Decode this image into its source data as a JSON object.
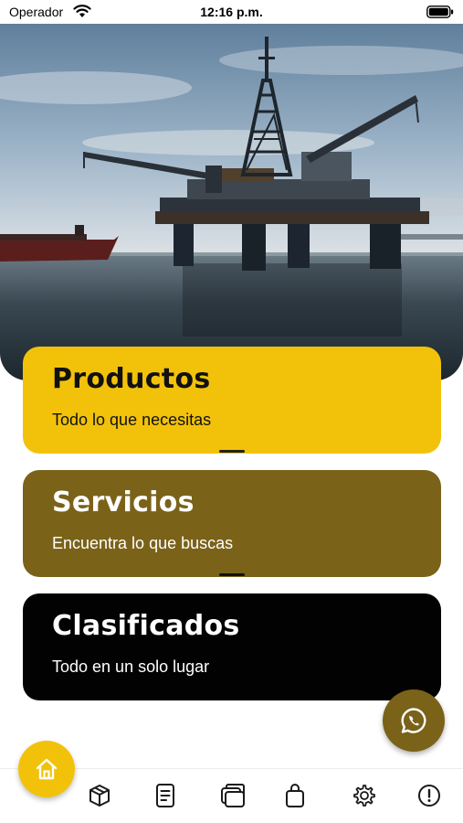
{
  "status_bar": {
    "carrier": "Operador",
    "time": "12:16 p.m."
  },
  "hero": {
    "image": "offshore-oil-platform-image"
  },
  "cards": [
    {
      "title": "Productos",
      "subtitle": "Todo lo que necesitas",
      "color": "#f2c20a"
    },
    {
      "title": "Servicios",
      "subtitle": "Encuentra lo que buscas",
      "color": "#7a6219"
    },
    {
      "title": "Clasificados",
      "subtitle": "Todo en un solo lugar",
      "color": "#020202"
    }
  ],
  "fab": {
    "whatsapp_icon": "whatsapp-icon",
    "whatsapp_color": "#7a6219"
  },
  "bottom_nav": {
    "active": "home",
    "active_color": "#f2c20a",
    "items": [
      "home-icon",
      "box-icon",
      "document-icon",
      "cards-icon",
      "bag-icon",
      "gear-icon",
      "alert-icon"
    ]
  }
}
